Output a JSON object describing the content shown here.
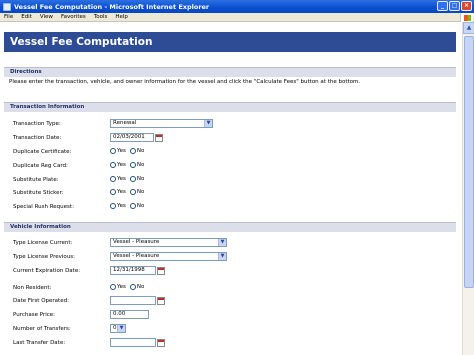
{
  "window": {
    "title": "Vessel Fee Computation - Microsoft Internet Explorer"
  },
  "menu": [
    "File",
    "Edit",
    "View",
    "Favorites",
    "Tools",
    "Help"
  ],
  "page": {
    "title": "Vessel Fee Computation",
    "directions": {
      "heading": "Directions",
      "text": "Please enter the transaction, vehicle, and owner information for the vessel and click the \"Calculate Fees\" button at the bottom."
    },
    "transaction": {
      "heading": "Transaction Information",
      "type_label": "Transaction Type:",
      "type_value": "Renewal",
      "date_label": "Transaction Date:",
      "date_value": "02/03/2001",
      "dup_cert_label": "Duplicate Certificate:",
      "dup_reg_label": "Duplicate Reg Card:",
      "sub_plate_label": "Substitute Plate:",
      "sub_sticker_label": "Substitute Sticker:",
      "rush_label": "Special Rush Request:"
    },
    "vehicle": {
      "heading": "Vehicle Information",
      "lic_current_label": "Type License Current:",
      "lic_current_value": "Vessel - Pleasure",
      "lic_previous_label": "Type License Previous:",
      "lic_previous_value": "Vessel - Pleasure",
      "exp_label": "Current Expiration Date:",
      "exp_value": "12/31/1998",
      "nonres_label": "Non Resident:",
      "first_op_label": "Date First Operated:",
      "first_op_value": "",
      "price_label": "Purchase Price:",
      "price_value": "0.00",
      "transfers_label": "Number of Transfers:",
      "transfers_value": "0",
      "last_transfer_label": "Last Transfer Date:",
      "last_transfer_value": ""
    },
    "radio": {
      "yes": "Yes",
      "no": "No"
    }
  }
}
